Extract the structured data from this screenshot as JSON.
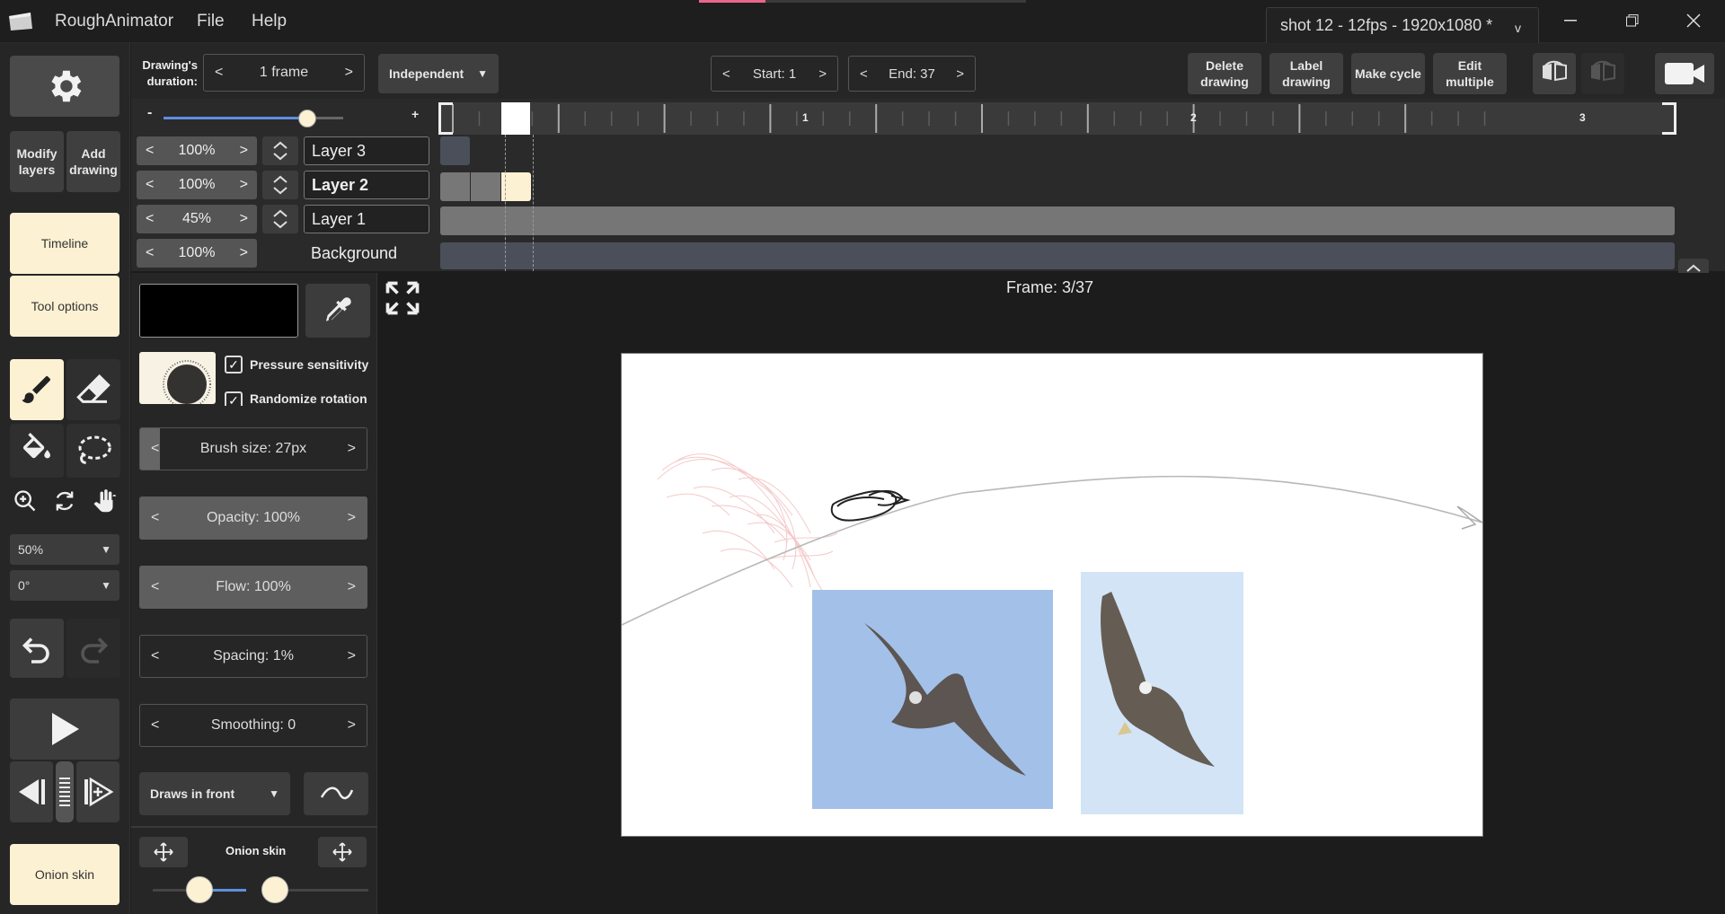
{
  "app": {
    "name": "RoughAnimator",
    "menu": [
      "File",
      "Help"
    ]
  },
  "document_tab": {
    "title": "shot 12 - 12fps - 1920x1080 *",
    "chevron": "v"
  },
  "header": {
    "drawing_duration_label": "Drawing's duration:",
    "duration_value": "1 frame",
    "mode_select": "Independent",
    "start_label": "Start: 1",
    "end_label": "End: 37",
    "buttons": {
      "delete": "Delete drawing",
      "label": "Label drawing",
      "cycle": "Make cycle",
      "edit": "Edit multiple"
    }
  },
  "sidebar": {
    "modify_layers": "Modify layers",
    "add_drawing": "Add drawing",
    "timeline": "Timeline",
    "tool_options": "Tool options",
    "zoom": "50%",
    "rotation": "0°",
    "onion_skin": "Onion skin"
  },
  "timeline": {
    "zoom_minus": "-",
    "zoom_plus": "+",
    "ruler_marks": [
      "1",
      "2",
      "3"
    ],
    "layers": [
      {
        "opacity": "100%",
        "name": "Layer 3"
      },
      {
        "opacity": "100%",
        "name": "Layer 2"
      },
      {
        "opacity": "45%",
        "name": "Layer 1"
      },
      {
        "opacity": "100%",
        "name": "Background"
      }
    ]
  },
  "tool_options": {
    "pressure_sensitivity": "Pressure sensitivity",
    "randomize_rotation": "Randomize rotation",
    "brush_size": "Brush size: 27px",
    "opacity": "Opacity: 100%",
    "flow": "Flow: 100%",
    "spacing": "Spacing: 1%",
    "smoothing": "Smoothing: 0",
    "draw_order": "Draws in front",
    "onion_skin_label": "Onion skin",
    "onion_before_level": 0.5,
    "onion_after_level": 0.0,
    "timeline_zoom_level": 0.8
  },
  "canvas": {
    "frame_label": "Frame: 3/37"
  },
  "colors": {
    "accent_cream": "#fdf1d3",
    "current_color": "#000000",
    "onion_red": "#e88a8a",
    "photo_blue": "#a3c0e8",
    "slider_blue": "#5f8ee0"
  },
  "arrows": {
    "left": "<",
    "right": ">"
  }
}
